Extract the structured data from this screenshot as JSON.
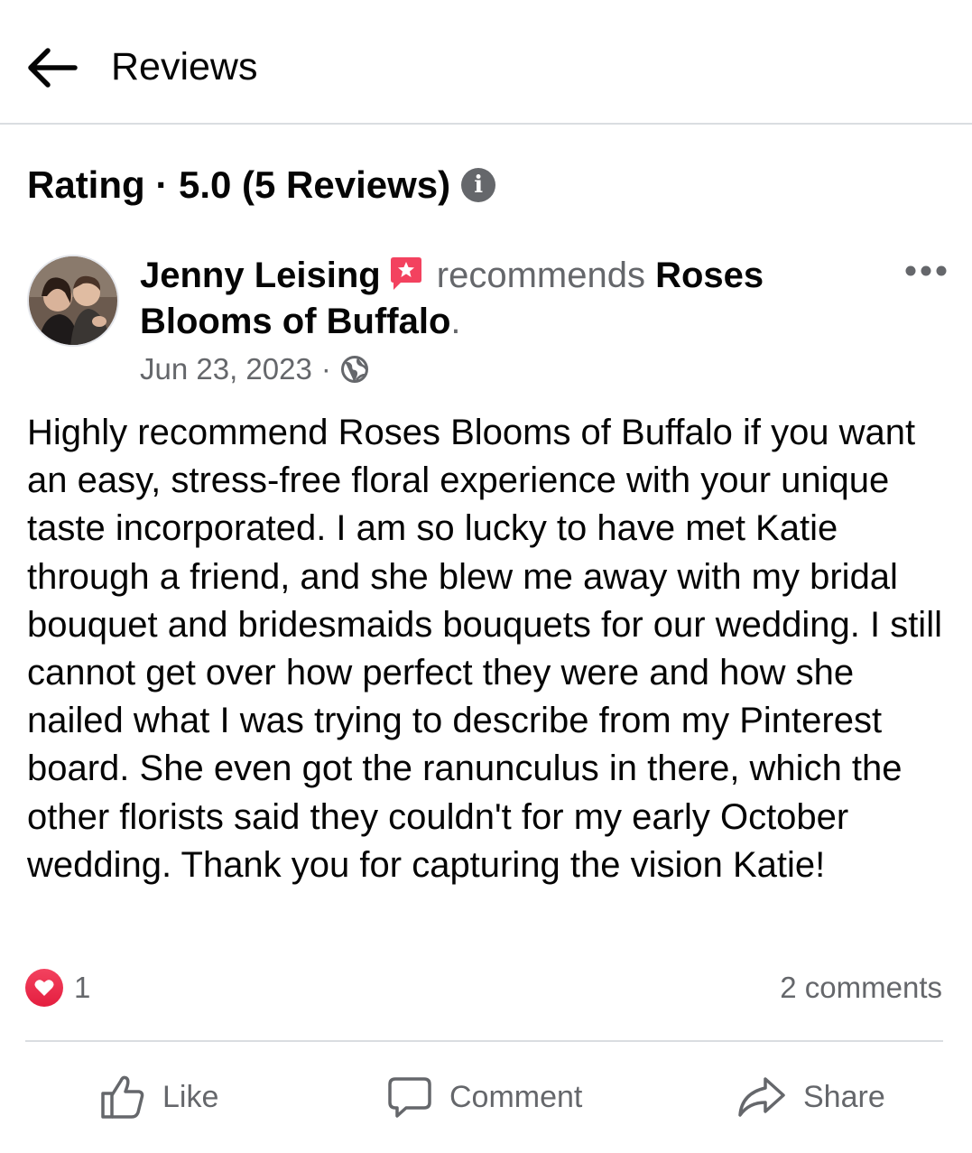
{
  "header": {
    "title": "Reviews",
    "back_icon": "back-arrow-icon"
  },
  "rating": {
    "label": "Rating · 5.0 (5 Reviews)",
    "info_icon": "info-icon"
  },
  "review": {
    "author": "Jenny Leising",
    "verb": "recommends",
    "business": "Roses Blooms of Buffalo",
    "period": ".",
    "date": "Jun 23, 2023",
    "separator": "·",
    "privacy_icon": "globe-icon",
    "recommend_badge_icon": "recommend-star-icon",
    "text": "Highly recommend Roses Blooms of Buffalo if you want an easy, stress-free floral experience with your unique taste incorporated. I am so lucky to have met Katie through a friend, and she blew me away with my bridal bouquet and bridesmaids bouquets for our wedding. I still cannot get over how perfect they were and how she nailed what I was trying to describe from my Pinterest board. She even got the ranunculus in there, which the other florists said they couldn't for my early October wedding. Thank you for capturing the vision Katie!",
    "reaction_count": "1",
    "comments": "2 comments"
  },
  "actions": {
    "like": "Like",
    "comment": "Comment",
    "share": "Share"
  },
  "colors": {
    "text_primary": "#050505",
    "text_secondary": "#65676b",
    "divider": "#dadde1",
    "love_red": "#e41e3f",
    "badge_pink": "#f3425f"
  }
}
